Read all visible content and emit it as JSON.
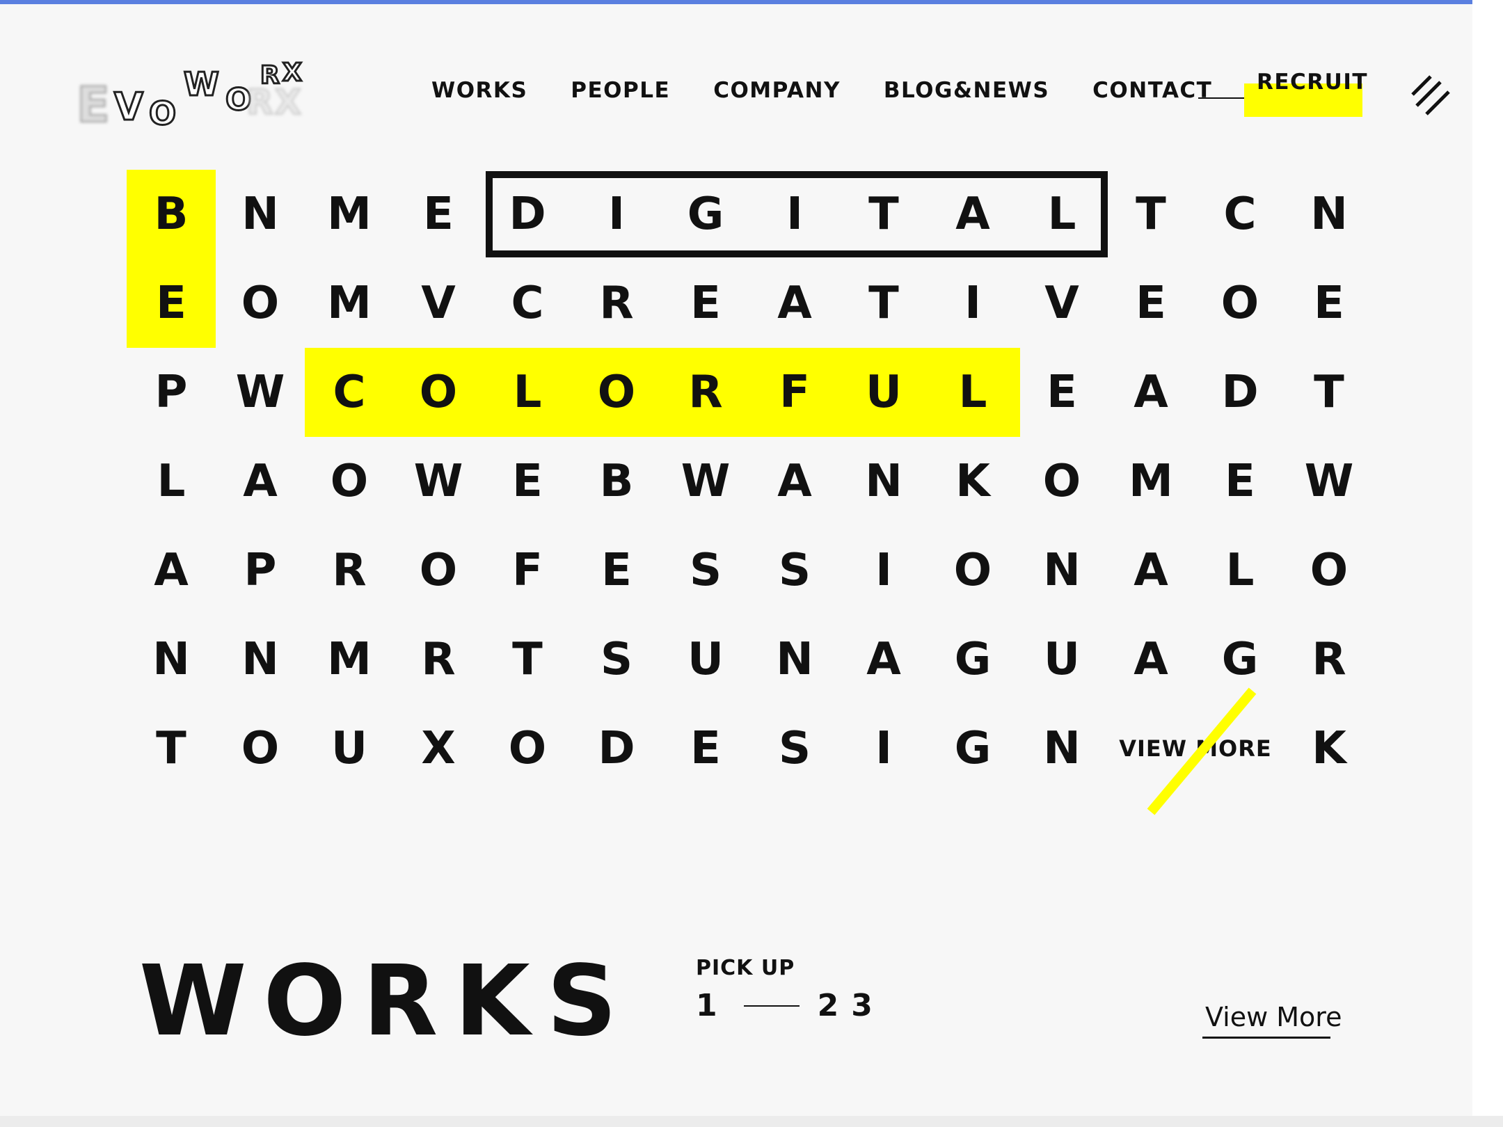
{
  "brand": {
    "logo_text": "EVOWORX"
  },
  "nav": {
    "items": [
      "WORKS",
      "PEOPLE",
      "COMPANY",
      "BLOG&NEWS",
      "CONTACT"
    ],
    "recruit_label": "RECRUIT",
    "menu_icon": "hamburger-slash-icon"
  },
  "colors": {
    "highlight": "#ffff00",
    "accent_top": "#5a7fe0",
    "text": "#111111",
    "background": "#f7f7f7"
  },
  "grid": {
    "rows": [
      [
        "B",
        "N",
        "M",
        "E",
        "D",
        "I",
        "G",
        "I",
        "T",
        "A",
        "L",
        "T",
        "C",
        "N"
      ],
      [
        "E",
        "O",
        "M",
        "V",
        "C",
        "R",
        "E",
        "A",
        "T",
        "I",
        "V",
        "E",
        "O",
        "E"
      ],
      [
        "P",
        "W",
        "C",
        "O",
        "L",
        "O",
        "R",
        "F",
        "U",
        "L",
        "E",
        "A",
        "D",
        "T"
      ],
      [
        "L",
        "A",
        "O",
        "W",
        "E",
        "B",
        "W",
        "A",
        "N",
        "K",
        "O",
        "M",
        "E",
        "W"
      ],
      [
        "A",
        "P",
        "R",
        "O",
        "F",
        "E",
        "S",
        "S",
        "I",
        "O",
        "N",
        "A",
        "L",
        "O"
      ],
      [
        "N",
        "N",
        "M",
        "R",
        "T",
        "S",
        "U",
        "N",
        "A",
        "G",
        "U",
        "A",
        "G",
        "R"
      ],
      [
        "T",
        "O",
        "U",
        "X",
        "O",
        "D",
        "E",
        "S",
        "I",
        "G",
        "N",
        "VIEW MORE",
        "K"
      ]
    ],
    "highlighted_words": [
      "BE",
      "COLORFUL"
    ],
    "boxed_word": "DIGITAL",
    "view_more_label": "VIEW MORE"
  },
  "works": {
    "title": "WORKS",
    "pickup_label": "PICK UP",
    "pages": [
      "1",
      "2",
      "3"
    ],
    "current_page": "1",
    "view_more": "View More"
  }
}
